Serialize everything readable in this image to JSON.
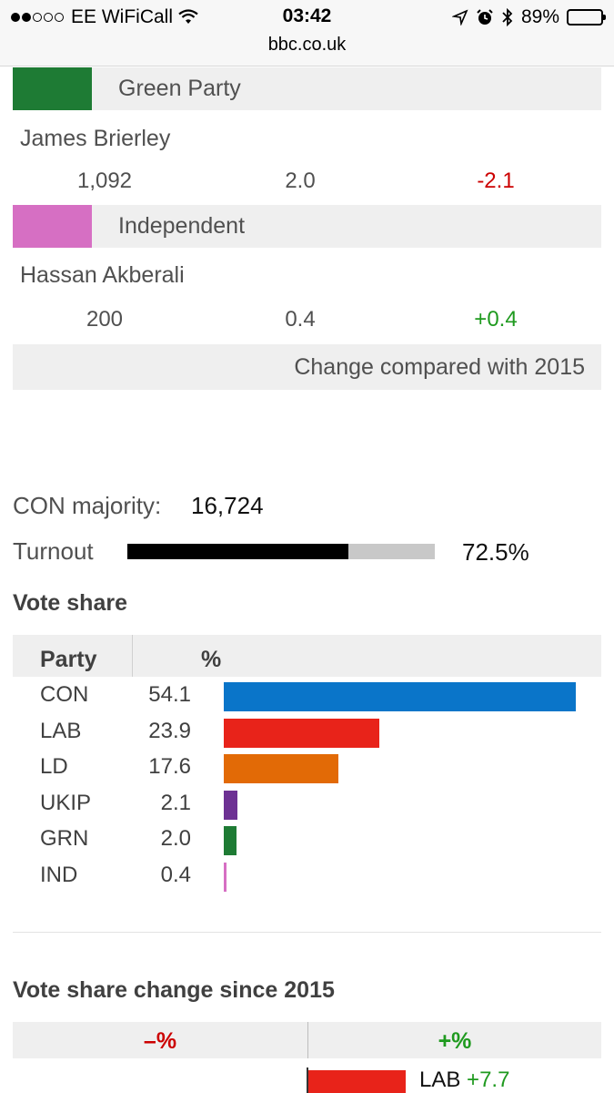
{
  "status_bar": {
    "carrier": "EE WiFiCall",
    "time": "03:42",
    "url": "bbc.co.uk",
    "battery": "89%",
    "battery_level": 0.89
  },
  "candidates": [
    {
      "party": "Green Party",
      "color": "#1e7b34",
      "name": "James Brierley",
      "votes": "1,092",
      "share": "2.0",
      "change": "-2.1",
      "change_sign": "negative"
    },
    {
      "party": "Independent",
      "color": "#d66fc3",
      "name": "Hassan Akberali",
      "votes": "200",
      "share": "0.4",
      "change": "+0.4",
      "change_sign": "positive"
    }
  ],
  "change_note": "Change compared with 2015",
  "majority": {
    "label": "CON majority:",
    "value": "16,724"
  },
  "turnout": {
    "label": "Turnout",
    "value": "72.5%",
    "fraction": 0.725
  },
  "vote_share": {
    "title": "Vote share",
    "header_party": "Party",
    "header_pct": "%"
  },
  "chart_data": [
    {
      "type": "bar",
      "title": "Vote share",
      "categories": [
        "CON",
        "LAB",
        "LD",
        "UKIP",
        "GRN",
        "IND"
      ],
      "values": [
        54.1,
        23.9,
        17.6,
        2.1,
        2.0,
        0.4
      ],
      "value_labels": [
        "54.1",
        "23.9",
        "17.6",
        "2.1",
        "2.0",
        "0.4"
      ],
      "colors": [
        "#0a75c9",
        "#e8231a",
        "#e26a06",
        "#6d3193",
        "#1e7b34",
        "#d66fc3"
      ],
      "orientation": "horizontal"
    },
    {
      "type": "bar",
      "title": "Vote share change since 2015",
      "header_negative": "–%",
      "header_positive": "+%",
      "categories": [
        "LAB"
      ],
      "values": [
        7.7
      ],
      "value_labels": [
        "+7.7"
      ],
      "colors": [
        "#e8231a"
      ],
      "orientation": "horizontal"
    }
  ]
}
